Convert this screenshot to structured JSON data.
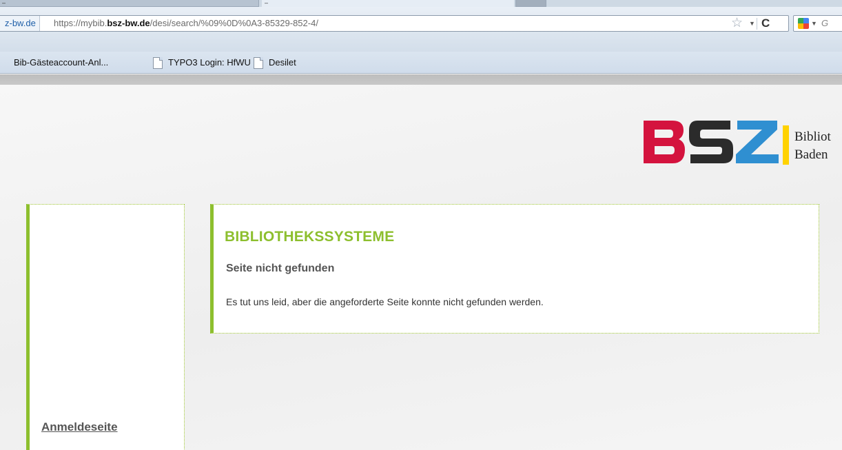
{
  "browser": {
    "tab_glyph_1": "–",
    "tab_glyph_2": "–",
    "identity": "z-bw.de",
    "url": {
      "prefix": "https://mybib.",
      "domain": "bsz-bw.de",
      "path": "/desi/search/%09%0D%0A3-85329-852-4/"
    },
    "search_placeholder": "G",
    "bookmarks": [
      {
        "label": "Bib-Gästeaccount-Anl..."
      },
      {
        "label": "TYPO3 Login: HfWU"
      },
      {
        "label": "Desilet"
      }
    ],
    "icons": {
      "star": "☆",
      "dropdown": "▼",
      "reload": "C",
      "search_engine": "google-icon"
    }
  },
  "logo": {
    "text": "BSZ",
    "caption_line1": "Bibliot",
    "caption_line2": "Baden",
    "colors": {
      "b": "#d4133e",
      "s": "#333333",
      "z": "#2f8fd1",
      "bar": "#ffd200"
    }
  },
  "sidebar": {
    "link": "Anmeldeseite"
  },
  "content": {
    "title": "BIBLIOTHEKSSYSTEME",
    "subtitle": "Seite nicht gefunden",
    "message": "Es tut uns leid, aber die angeforderte Seite konnte nicht gefunden werden."
  },
  "colors": {
    "accent_green": "#8dbf2e"
  }
}
